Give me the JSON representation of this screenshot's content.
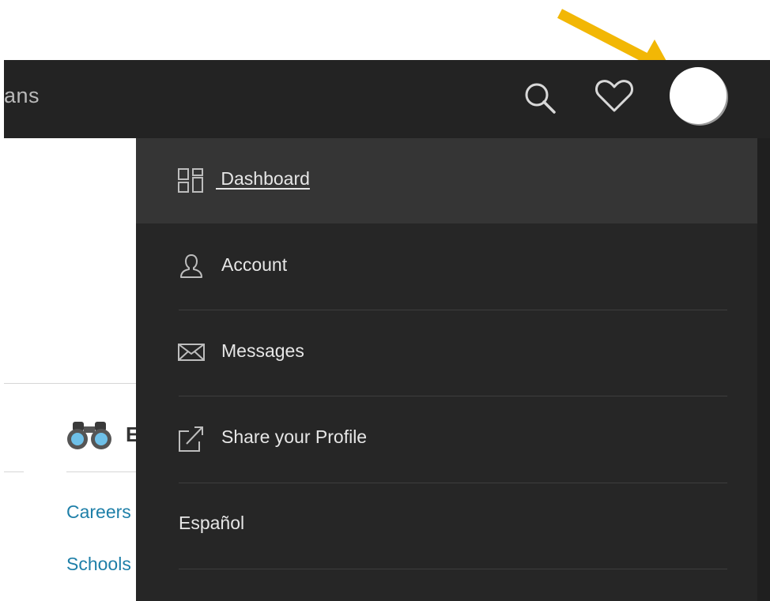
{
  "header": {
    "nav_partial_text": "ans",
    "icons": [
      "search-icon",
      "heart-icon"
    ],
    "avatar_color": "#ffffff",
    "bar_color": "#232323"
  },
  "annotation": {
    "arrow_color": "#f2b705"
  },
  "page": {
    "section_heading_partial": "E",
    "links": [
      "Careers",
      "Schools"
    ],
    "link_color": "#1e7fa8"
  },
  "dropdown": {
    "items": [
      {
        "label": " Dashboard",
        "icon": "dashboard-grid-icon",
        "active": true
      },
      {
        "label": "Account",
        "icon": "user-icon",
        "active": false
      },
      {
        "label": "Messages",
        "icon": "envelope-icon",
        "active": false
      },
      {
        "label": "Share your Profile",
        "icon": "share-icon",
        "active": false
      },
      {
        "label": "Español",
        "icon": "",
        "active": false
      }
    ]
  }
}
